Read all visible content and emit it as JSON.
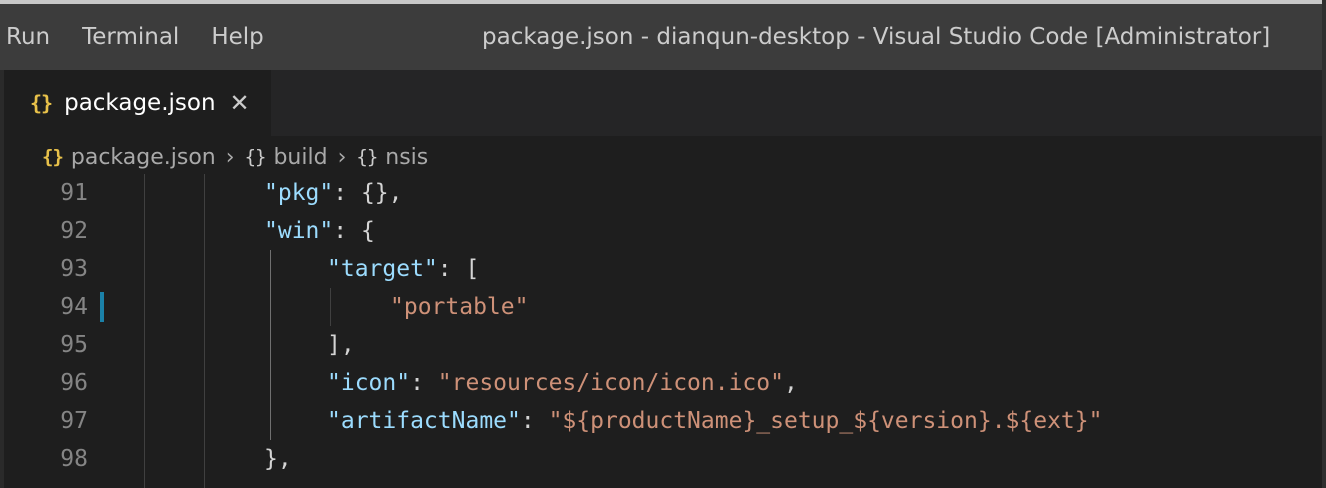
{
  "menu": {
    "items": [
      "Run",
      "Terminal",
      "Help"
    ]
  },
  "window_title": "package.json - dianqun-desktop - Visual Studio Code [Administrator]",
  "tab": {
    "icon": "{}",
    "label": "package.json",
    "close": "✕"
  },
  "breadcrumb": {
    "items": [
      {
        "icon": "{}",
        "label": "package.json"
      },
      {
        "icon": "{}",
        "label": "build"
      },
      {
        "icon": "{}",
        "label": "nsis"
      }
    ],
    "separator": "›"
  },
  "editor": {
    "lines": [
      {
        "number": "91",
        "key": "\"pkg\"",
        "sep": ": ",
        "rest": "{},",
        "value": ""
      },
      {
        "number": "92",
        "key": "\"win\"",
        "sep": ": ",
        "rest": "{",
        "value": ""
      },
      {
        "number": "93",
        "key": "\"target\"",
        "sep": ": ",
        "rest": "[",
        "value": ""
      },
      {
        "number": "94",
        "key": "",
        "sep": "",
        "rest": "",
        "value": "\"portable\""
      },
      {
        "number": "95",
        "key": "",
        "sep": "",
        "rest": "],",
        "value": ""
      },
      {
        "number": "96",
        "key": "\"icon\"",
        "sep": ": ",
        "rest": ",",
        "value": "\"resources/icon/icon.ico\""
      },
      {
        "number": "97",
        "key": "\"artifactName\"",
        "sep": ": ",
        "rest": "",
        "value": "\"${productName}_setup_${version}.${ext}\""
      },
      {
        "number": "98",
        "key": "",
        "sep": "",
        "rest": "},",
        "value": ""
      }
    ],
    "modified_line": "94"
  },
  "colors": {
    "background": "#1e1e1e",
    "titlebar": "#3c3c3c",
    "json_icon": "#e8c14a",
    "property_key": "#9cdcfe",
    "string_value": "#ce9178",
    "gutter_modified": "#1b81a8"
  }
}
